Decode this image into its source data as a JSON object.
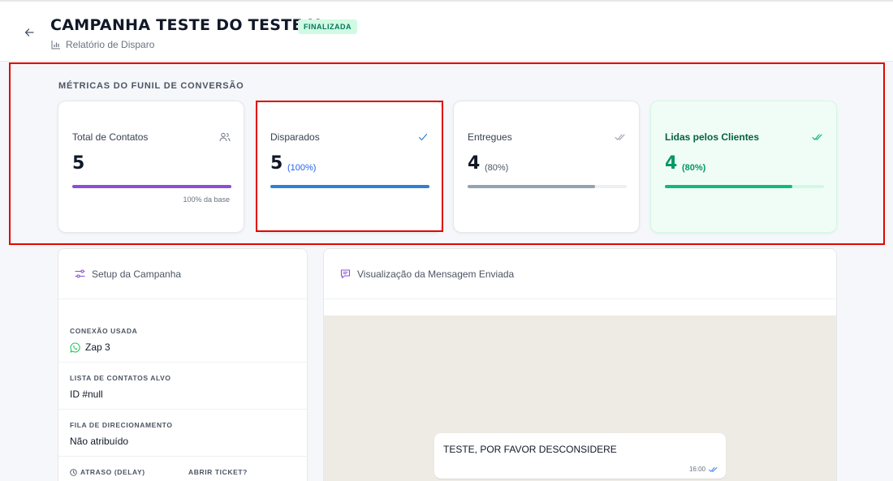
{
  "header": {
    "title": "CAMPANHA TESTE DO TESTE X",
    "status_badge": "FINALIZADA",
    "subtitle": "Relatório de Disparo"
  },
  "metrics": {
    "section_title": "MÉTRICAS DO FUNIL DE CONVERSÃO",
    "cards": [
      {
        "label": "Total de Contatos",
        "value": "5",
        "percent": "",
        "footnote": "100% da base",
        "icon": "users-icon",
        "bar_fraction": 1.0,
        "bar_color": "#8b4fd6"
      },
      {
        "label": "Disparados",
        "value": "5",
        "percent": "(100%)",
        "footnote": "",
        "icon": "check-icon",
        "bar_fraction": 1.0,
        "bar_color": "#2f80d4"
      },
      {
        "label": "Entregues",
        "value": "4",
        "percent": "(80%)",
        "footnote": "",
        "icon": "double-check-icon",
        "bar_fraction": 0.8,
        "bar_color": "#94a3b0"
      },
      {
        "label": "Lidas pelos Clientes",
        "value": "4",
        "percent": "(80%)",
        "footnote": "",
        "icon": "double-check-icon",
        "bar_fraction": 0.8,
        "bar_color": "#10b981"
      }
    ]
  },
  "setup": {
    "title": "Setup da Campanha",
    "connection_label": "CONEXÃO USADA",
    "connection_value": "Zap 3",
    "contact_list_label": "LISTA DE CONTATOS ALVO",
    "contact_list_value": "ID #null",
    "queue_label": "FILA DE DIRECIONAMENTO",
    "queue_value": "Não atribuído",
    "delay_label": "ATRASO (DELAY)",
    "ticket_label": "ABRIR TICKET?"
  },
  "preview": {
    "title": "Visualização da Mensagem Enviada",
    "message_text": "TESTE, POR FAVOR DESCONSIDERE",
    "message_time": "16:00"
  },
  "colors": {
    "accent_green": "#059669",
    "badge_bg": "#d1fae5",
    "highlight_red": "#e10600",
    "purple_icon": "#8b4fd6"
  }
}
